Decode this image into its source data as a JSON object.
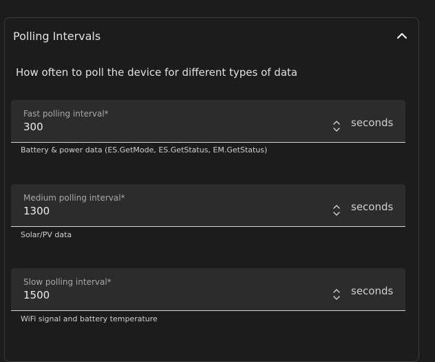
{
  "section": {
    "title": "Polling Intervals",
    "description": "How often to poll the device for different types of data"
  },
  "fields": [
    {
      "label": "Fast polling interval*",
      "value": "300",
      "unit": "seconds",
      "helper": "Battery & power data (ES.GetMode, ES.GetStatus, EM.GetStatus)"
    },
    {
      "label": "Medium polling interval*",
      "value": "1300",
      "unit": "seconds",
      "helper": "Solar/PV data"
    },
    {
      "label": "Slow polling interval*",
      "value": "1500",
      "unit": "seconds",
      "helper": "WiFi signal and battery temperature"
    }
  ],
  "icons": {
    "collapse": "chevron-up-icon",
    "spinner": "spin-arrows-icon"
  }
}
